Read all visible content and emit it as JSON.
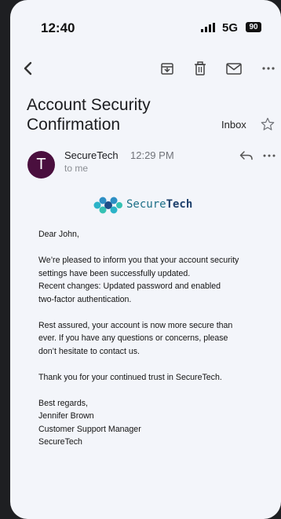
{
  "status_bar": {
    "time": "12:40",
    "network": "5G",
    "battery": "90"
  },
  "toolbar": {
    "back_icon": "chevron-left-icon",
    "archive_icon": "archive-icon",
    "delete_icon": "trash-icon",
    "mail_icon": "mail-icon",
    "more_icon": "more-horizontal-icon"
  },
  "email": {
    "subject": "Account Security Confirmation",
    "folder_label": "Inbox",
    "sender": {
      "avatar_letter": "T",
      "avatar_color": "#4a0f3e",
      "name": "SecureTech",
      "time": "12:29 PM",
      "recipient": "to me"
    },
    "logo": {
      "text_part1": "Secure",
      "text_part2": "Tech"
    },
    "body": {
      "greeting": "Dear John,",
      "p1_line1": "We’re pleased to inform you that your account security",
      "p1_line2": "settings have been successfully updated.",
      "p1_line3": "Recent changes: Updated password and enabled",
      "p1_line4": "two-factor authentication.",
      "p2_line1": "Rest assured, your account is now more secure than",
      "p2_line2": "ever. If you have any questions or concerns, please",
      "p2_line3": "don’t hesitate to contact us.",
      "p3": "Thank you for your continued trust in SecureTech.",
      "closing": "Best regards,",
      "sig_name": "Jennifer Brown",
      "sig_title": "Customer Support Manager",
      "sig_company": "SecureTech"
    }
  }
}
